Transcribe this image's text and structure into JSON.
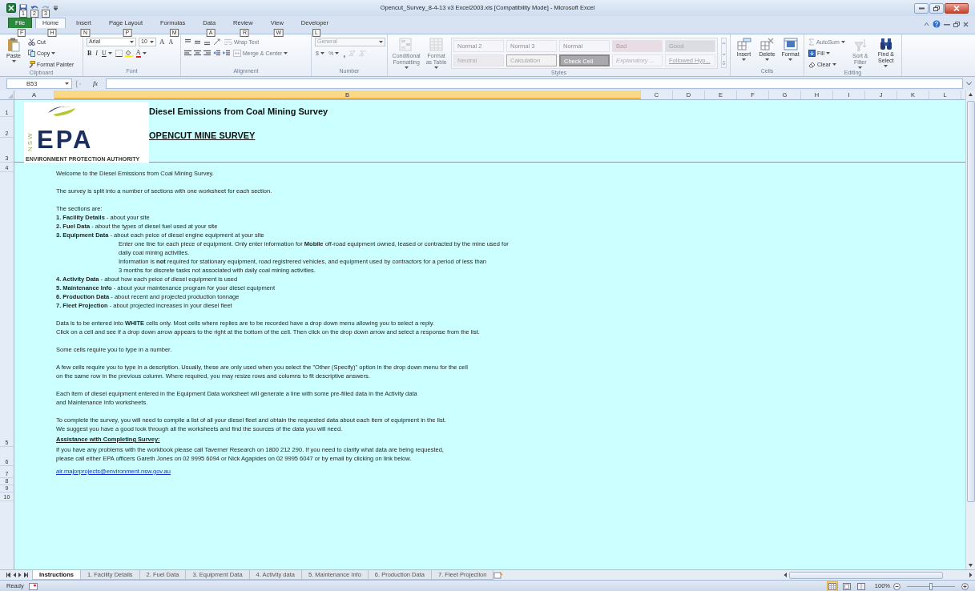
{
  "window": {
    "title": "Opencut_Survey_8-4-13 v3 Excel2003.xls  [Compatibility Mode]  -  Microsoft Excel"
  },
  "quick_access_keytips": [
    "1",
    "2",
    "3"
  ],
  "tabs": [
    {
      "label": "File",
      "keytip": "F",
      "kind": "file",
      "selected": false
    },
    {
      "label": "Home",
      "keytip": "H",
      "kind": "tab",
      "selected": true
    },
    {
      "label": "Insert",
      "keytip": "N",
      "kind": "tab",
      "selected": false
    },
    {
      "label": "Page Layout",
      "keytip": "P",
      "kind": "tab",
      "selected": false
    },
    {
      "label": "Formulas",
      "keytip": "M",
      "kind": "tab",
      "selected": false
    },
    {
      "label": "Data",
      "keytip": "A",
      "kind": "tab",
      "selected": false
    },
    {
      "label": "Review",
      "keytip": "R",
      "kind": "tab",
      "selected": false
    },
    {
      "label": "View",
      "keytip": "W",
      "kind": "tab",
      "selected": false
    },
    {
      "label": "Developer",
      "keytip": "L",
      "kind": "tab",
      "selected": false
    }
  ],
  "ribbon": [
    {
      "kind": "clipboard",
      "label": "Clipboard",
      "large": [
        {
          "kind": "paste",
          "label": "Paste",
          "disabled": false
        }
      ],
      "stack": [
        {
          "kind": "cut",
          "label": "Cut",
          "disabled": false
        },
        {
          "kind": "copy",
          "label": "Copy",
          "disabled": false
        },
        {
          "kind": "format_painter",
          "label": "Format Painter",
          "disabled": false
        }
      ]
    },
    {
      "kind": "font",
      "label": "Font",
      "top": [
        {
          "kind": "font_name",
          "value": "Arial",
          "disabled": false
        },
        {
          "kind": "font_size",
          "value": "10",
          "disabled": false
        },
        {
          "kind": "grow",
          "label": "A",
          "disabled": false
        },
        {
          "kind": "shrink",
          "label": "A",
          "disabled": false
        }
      ],
      "bottom": [
        {
          "kind": "bold",
          "label": "B",
          "disabled": false
        },
        {
          "kind": "italic",
          "label": "I",
          "disabled": false
        },
        {
          "kind": "underline",
          "label": "U",
          "disabled": false
        },
        {
          "kind": "borders",
          "disabled": false
        },
        {
          "kind": "fill_color",
          "disabled": false
        },
        {
          "kind": "font_color",
          "label": "A",
          "disabled": false
        }
      ]
    },
    {
      "kind": "alignment",
      "label": "Alignment",
      "top": [
        {
          "kind": "align_top",
          "disabled": false
        },
        {
          "kind": "align_middle",
          "disabled": false
        },
        {
          "kind": "align_bottom",
          "disabled": false
        },
        {
          "kind": "orientation",
          "disabled": false
        },
        {
          "kind": "wrap_text",
          "label": "Wrap Text",
          "disabled": true
        }
      ],
      "bottom": [
        {
          "kind": "align_left",
          "disabled": false
        },
        {
          "kind": "align_center",
          "disabled": false
        },
        {
          "kind": "align_right",
          "disabled": false
        },
        {
          "kind": "outdent",
          "disabled": false
        },
        {
          "kind": "indent",
          "disabled": false
        },
        {
          "kind": "merge",
          "label": "Merge & Center",
          "disabled": true
        }
      ]
    },
    {
      "kind": "number",
      "label": "Number",
      "top": [
        {
          "kind": "number_format",
          "value": "General",
          "disabled": true
        }
      ],
      "bottom": [
        {
          "kind": "currency",
          "label": "$",
          "disabled": true
        },
        {
          "kind": "percent",
          "label": "%",
          "disabled": true
        },
        {
          "kind": "comma",
          "label": ",",
          "disabled": true
        },
        {
          "kind": "inc_decimal",
          "disabled": true
        },
        {
          "kind": "dec_decimal",
          "disabled": true
        }
      ]
    },
    {
      "kind": "styles",
      "label": "Styles",
      "large": [
        {
          "kind": "conditional",
          "label": "Conditional Formatting",
          "disabled": true
        },
        {
          "kind": "format_table",
          "label": "Format as Table",
          "disabled": true
        }
      ],
      "gallery": [
        {
          "label": "Normal 2",
          "kind": "plain"
        },
        {
          "label": "Normal 3",
          "kind": "plain"
        },
        {
          "label": "Normal",
          "kind": "plain"
        },
        {
          "label": "Bad",
          "kind": "bad"
        },
        {
          "label": "Good",
          "kind": "good"
        },
        {
          "label": "Neutral",
          "kind": "neutral"
        },
        {
          "label": "Calculation",
          "kind": "calculation"
        },
        {
          "label": "Check Cell",
          "kind": "check"
        },
        {
          "label": "Explanatory ...",
          "kind": "explanatory"
        },
        {
          "label": "Followed Hyp...",
          "kind": "hyperlink"
        }
      ]
    },
    {
      "kind": "cells",
      "label": "Cells",
      "large": [
        {
          "kind": "insert",
          "label": "Insert",
          "disabled": false
        },
        {
          "kind": "delete",
          "label": "Delete",
          "disabled": false
        },
        {
          "kind": "format",
          "label": "Format",
          "disabled": false
        }
      ]
    },
    {
      "kind": "editing",
      "label": "Editing",
      "stack": [
        {
          "kind": "autosum",
          "label": "AutoSum",
          "disabled": true
        },
        {
          "kind": "fill",
          "label": "Fill",
          "disabled": false
        },
        {
          "kind": "clear",
          "label": "Clear",
          "disabled": false
        }
      ],
      "large_after": [
        {
          "kind": "sort",
          "label": "Sort & Filter",
          "disabled": true
        },
        {
          "kind": "find",
          "label": "Find & Select",
          "disabled": false
        }
      ]
    }
  ],
  "formula_bar": {
    "name_box": "B53",
    "function_label": "fx"
  },
  "columns": [
    {
      "label": "A",
      "selected": false
    },
    {
      "label": "B",
      "selected": true
    },
    {
      "label": "C",
      "selected": false
    },
    {
      "label": "D",
      "selected": false
    },
    {
      "label": "E",
      "selected": false
    },
    {
      "label": "F",
      "selected": false
    },
    {
      "label": "G",
      "selected": false
    },
    {
      "label": "H",
      "selected": false
    },
    {
      "label": "I",
      "selected": false
    },
    {
      "label": "J",
      "selected": false
    },
    {
      "label": "K",
      "selected": false
    },
    {
      "label": "L",
      "selected": false
    }
  ],
  "rows": [
    "1",
    "2",
    "3",
    "4",
    "5",
    "6",
    "7",
    "8",
    "9",
    "10"
  ],
  "sheet": {
    "logo": {
      "initials": "EPA",
      "state": "NSW",
      "caption": "ENVIRONMENT PROTECTION AUTHORITY"
    },
    "title": "Diesel Emissions from Coal Mining Survey",
    "subtitle": "OPENCUT MINE SURVEY",
    "paragraphs": [
      {
        "lines": [
          "Welcome to the Diesel Emissions from Coal Mining Survey."
        ]
      },
      {
        "lines": [
          "The survey is split into a number of sections with one worksheet for each section."
        ]
      },
      {
        "lines": [
          "The sections are:",
          "**1. Facility Details** - about your site",
          "**2. Fuel Data** - about the types of diesel fuel used at your site",
          "**3. Equipment Data** - about each peice of diesel engine equipment at your site"
        ],
        "details": [
          "Enter one line for each piece of equipment.  Only enter information for **Mobile** off-road equipment owned, leased or contracted by the mine used for",
          "daily coal mining activities.",
          "Information is **not** required for stationary equipment, road registrered vehicles, and equipment used by contractors for a period of less than",
          "3 months for discrete tasks not associated with daily coal mining activities."
        ],
        "more_lines": [
          "**4. Activity Data** - about how each peice of diesel equipment is used",
          "**5. Maintenance Info** - about your maintenance program for your diesel equipment",
          "**6. Production Data** - about recent and projected production tonnage",
          "**7. Fleet Projection** - about projected increases in your diesel fleet"
        ]
      },
      {
        "lines": [
          "Data is to be entered into **WHITE** cells only.  Most cells where replies are to be recorded have a drop down menu allowing you to select a reply.",
          "Click on a cell and see if a drop down arrow appears to the right at the bottom of the cell. Then click on the drop down arrow and select a response from the list."
        ]
      },
      {
        "lines": [
          "Some cells require you to type in a number."
        ]
      },
      {
        "lines": [
          "A few cells require you to type in a description. Usually, these are only used when you select the \"Other (Specify)\" option in the drop down menu for the cell",
          "on the same row in the previous column.  Where required, you may resize rows and columns to fit descriptive answers."
        ]
      },
      {
        "lines": [
          "Each item of diesel equipment entered in the Equipment Data worksheet will generate a line with some pre-filled data in the Activity data",
          "and Maintenance Info worksheets."
        ]
      },
      {
        "lines": [
          "To complete the survey, you will need to compile a list of all your diesel fleet and obtain the requested data about each item of equipment in the list.",
          "We suggest you have a good look through all the worksheets and find the sources of the data you will need."
        ]
      }
    ],
    "assistance": {
      "heading": "Assistance with Completing Survey:",
      "lines": [
        "If you have any problems with the workbook please call Taverner Research on 1800 212 290. If you need to clarify what data are being requested,",
        "please call either EPA officers Gareth Jones on 02 9995 6094 or Nick Agapides on 02 9995 6047 or by email by clicking on link below."
      ],
      "email": "air.majorprojects@environment.nsw.gov.au"
    }
  },
  "sheet_tabs": [
    {
      "label": "Instructions",
      "selected": true
    },
    {
      "label": "1. Facility Details",
      "selected": false
    },
    {
      "label": "2. Fuel Data",
      "selected": false
    },
    {
      "label": "3. Equipment Data",
      "selected": false
    },
    {
      "label": "4. Activity data",
      "selected": false
    },
    {
      "label": "5. Maintenance Info",
      "selected": false
    },
    {
      "label": "6. Production Data",
      "selected": false
    },
    {
      "label": "7. Fleet Projection",
      "selected": false
    }
  ],
  "status_bar": {
    "status": "Ready",
    "views": [
      {
        "kind": "normal",
        "selected": true
      },
      {
        "kind": "page_layout",
        "selected": false
      },
      {
        "kind": "page_break",
        "selected": false
      }
    ],
    "zoom": {
      "label": "100%",
      "level": 0.5
    }
  }
}
